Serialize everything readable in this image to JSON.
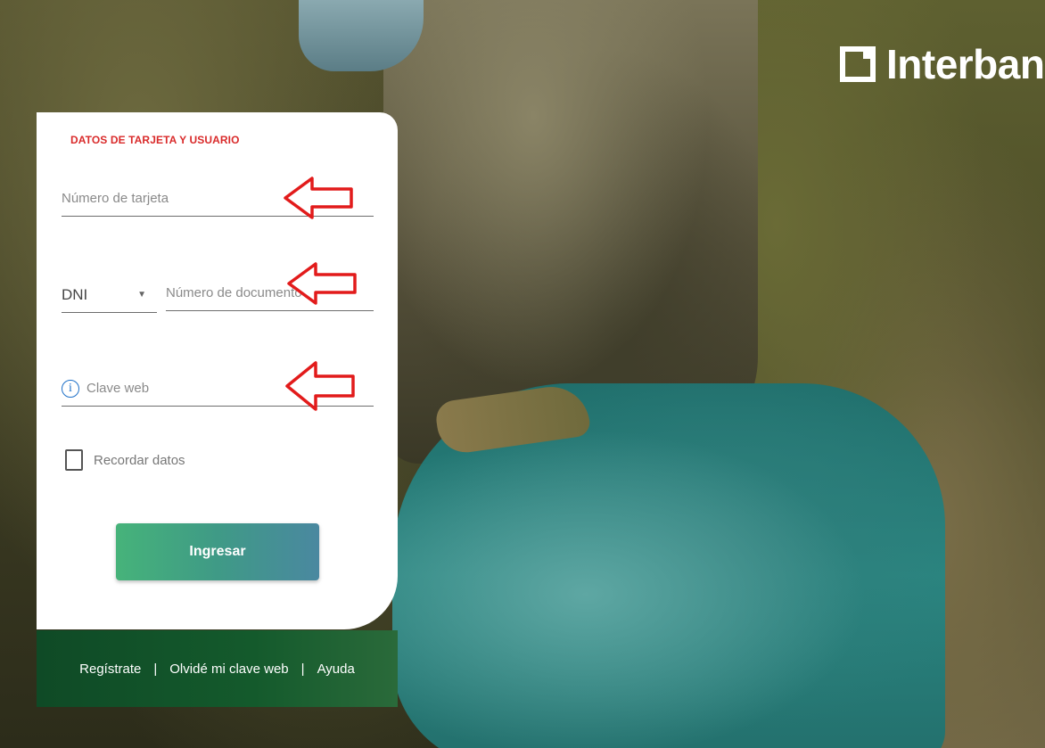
{
  "brand": {
    "logo_text": "Interbank"
  },
  "login": {
    "section_title": "DATOS DE TARJETA Y USUARIO",
    "card_placeholder": "Número de tarjeta",
    "doc_type_value": "DNI",
    "doc_number_placeholder": "Número de documento",
    "password_placeholder": "Clave web",
    "info_icon_glyph": "i",
    "remember_label": "Recordar datos",
    "submit_label": "Ingresar"
  },
  "footer": {
    "links": [
      "Regístrate",
      "Olvidé mi clave web",
      "Ayuda"
    ],
    "separator": "|"
  },
  "annotations": {
    "arrow_color": "#e21b1b",
    "arrow_icon": "left-arrow-outline-icon"
  },
  "colors": {
    "title_red": "#d92a2a",
    "button_gradient_start": "#46b37a",
    "button_gradient_end": "#4a88a0",
    "footer_green": "#0f4a26",
    "info_blue": "#1e70c8"
  }
}
